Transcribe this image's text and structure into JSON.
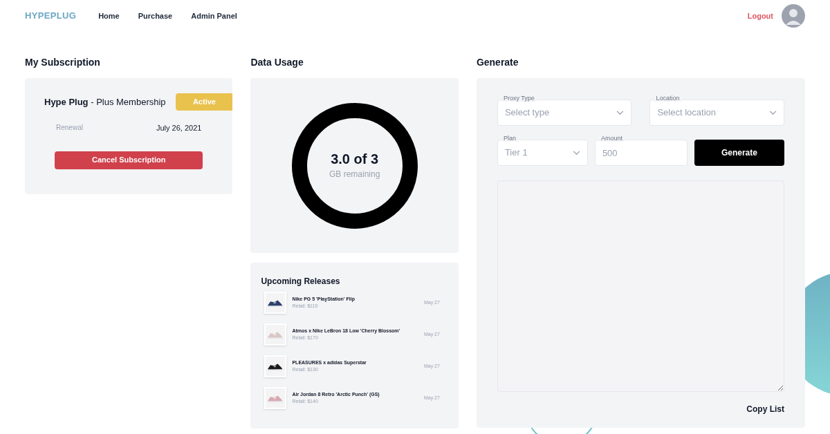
{
  "nav": {
    "logo": "HYPEPLUG",
    "links": [
      "Home",
      "Purchase",
      "Admin Panel"
    ],
    "logout": "Logout"
  },
  "subscription": {
    "heading": "My Subscription",
    "product": "Hype Plug",
    "plan": " - Plus Membership",
    "status": "Active",
    "renewal_label": "Renewal",
    "renewal_date": "July 26, 2021",
    "cancel": "Cancel Subscription"
  },
  "usage": {
    "heading": "Data Usage",
    "amount": "3.0 of 3",
    "unit": "GB remaining"
  },
  "releases": {
    "heading": "Upcoming Releases",
    "items": [
      {
        "name": "Nike PG 5 'PlayStation' Flip",
        "retail": "Retail: $110",
        "date": "May 27"
      },
      {
        "name": "Atmos x Nike LeBron 18 Low 'Cherry Blossom'",
        "retail": "Retail: $170",
        "date": "May 27"
      },
      {
        "name": "PLEASURES x adidas Superstar",
        "retail": "Retail: $130",
        "date": "May 27"
      },
      {
        "name": "Air Jordan 8 Retro 'Arctic Punch' (GS)",
        "retail": "Retail: $140",
        "date": "May 27"
      }
    ]
  },
  "generate": {
    "heading": "Generate",
    "proxy_type": {
      "label": "Proxy Type",
      "placeholder": "Select type"
    },
    "location": {
      "label": "Location",
      "placeholder": "Select location"
    },
    "plan": {
      "label": "Plan",
      "value": "Tier 1"
    },
    "amount": {
      "label": "Amount",
      "placeholder": "500"
    },
    "button": "Generate",
    "copy": "Copy List"
  }
}
